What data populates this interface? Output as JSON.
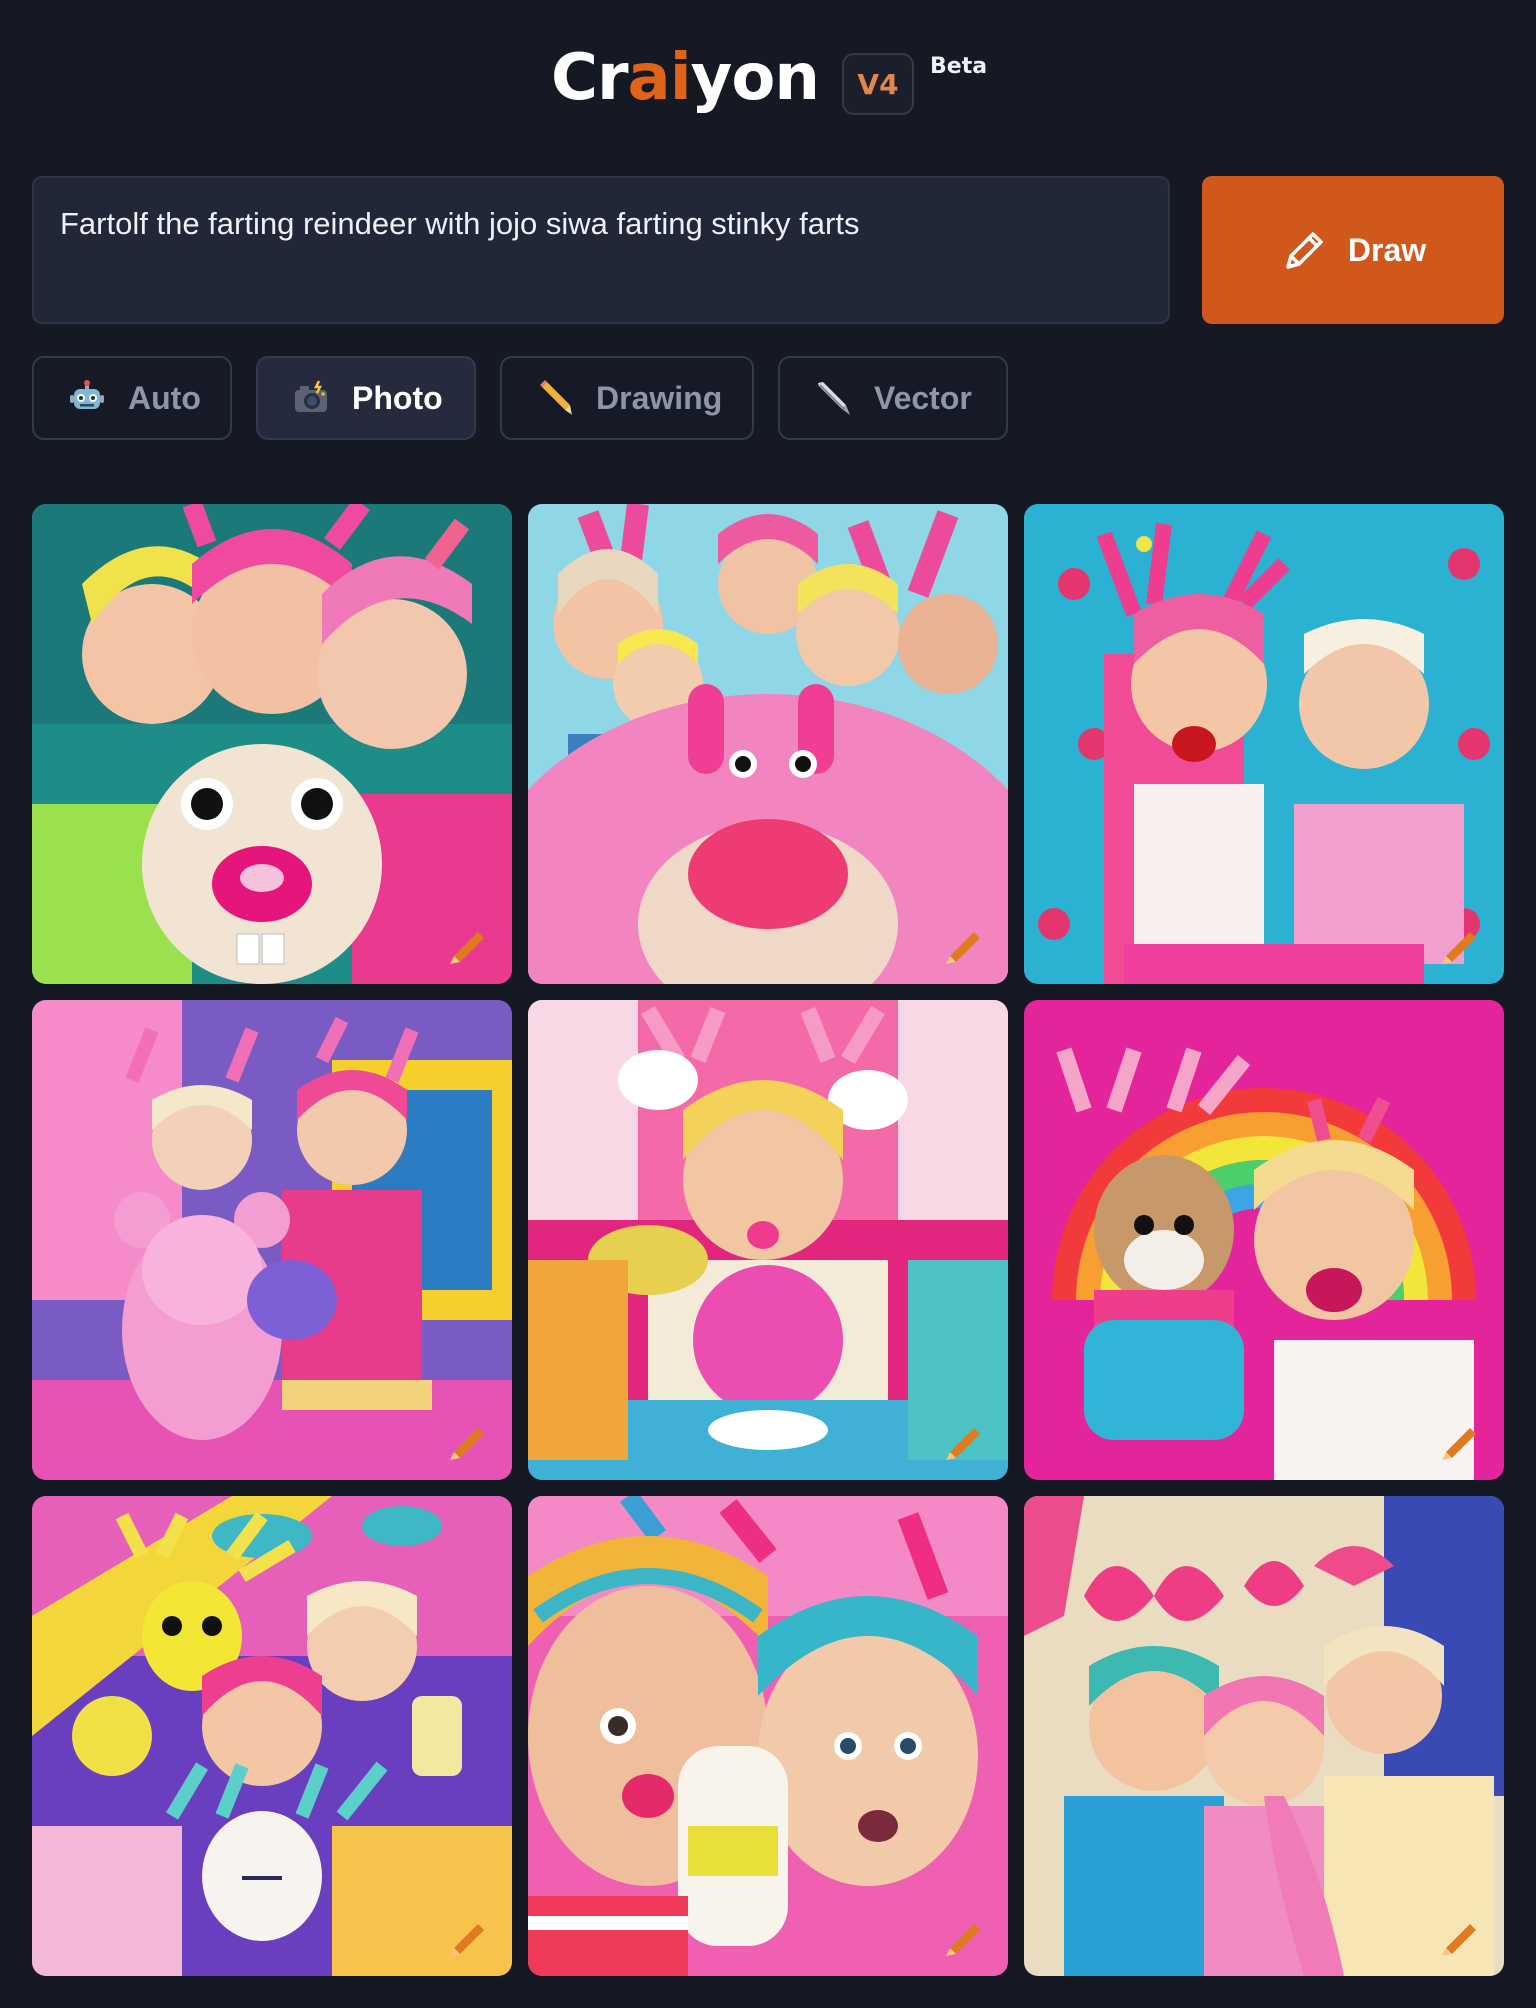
{
  "header": {
    "logo_pre": "Cr",
    "logo_ai": "ai",
    "logo_post": "yon",
    "version": "V4",
    "badge": "Beta"
  },
  "prompt": {
    "value": "Fartolf the farting reindeer with jojo siwa farting stinky farts"
  },
  "draw_button": {
    "label": "Draw",
    "icon": "pencil-icon"
  },
  "style_tabs": [
    {
      "label": "Auto",
      "icon": "robot-icon",
      "active": false
    },
    {
      "label": "Photo",
      "icon": "camera-flash-icon",
      "active": true
    },
    {
      "label": "Drawing",
      "icon": "pencil-icon",
      "active": false
    },
    {
      "label": "Vector",
      "icon": "pen-nib-icon",
      "active": false
    }
  ],
  "results": {
    "count": 9,
    "edit_icon": "crayon-edit-icon"
  },
  "colors": {
    "background": "#151924",
    "accent": "#d0581a",
    "logo_accent": "#e0631a",
    "input_bg": "#222738"
  }
}
